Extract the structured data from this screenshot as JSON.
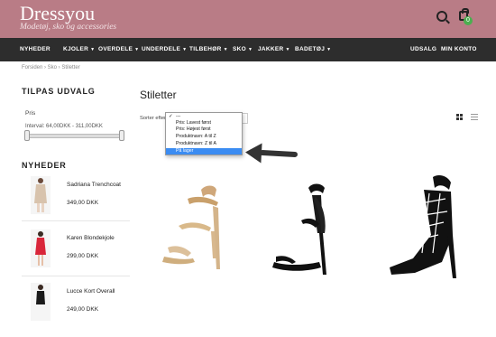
{
  "header": {
    "logo": "Dressyou",
    "tagline": "Modetøj, sko og accessories",
    "cart_count": "0",
    "brand_color": "#b97c86"
  },
  "nav": {
    "items": [
      {
        "label": "NYHEDER",
        "caret": false
      },
      {
        "label": "KJOLER",
        "caret": true
      },
      {
        "label": "OVERDELE",
        "caret": true
      },
      {
        "label": "UNDERDELE",
        "caret": true
      },
      {
        "label": "TILBEHØR",
        "caret": true
      },
      {
        "label": "SKO",
        "caret": true
      },
      {
        "label": "JAKKER",
        "caret": true
      },
      {
        "label": "BADETØJ",
        "caret": true
      }
    ],
    "right": [
      {
        "label": "UDSALG"
      },
      {
        "label": "MIN KONTO"
      }
    ]
  },
  "breadcrumb": "Forsiden  ›  Sko  ›  Stiletter",
  "sidebar": {
    "filter_title": "TILPAS UDVALG",
    "price_label": "Pris",
    "interval": "Interval: 64,00DKK - 311,00DKK",
    "new_title": "NYHEDER",
    "products": [
      {
        "name": "Sadriana Trenchcoat",
        "price": "349,00 DKK"
      },
      {
        "name": "Karen Blondekjole",
        "price": "299,00 DKK"
      },
      {
        "name": "Lucce Kort Overall",
        "price": "249,00 DKK"
      }
    ]
  },
  "main": {
    "title": "Stiletter",
    "sort_label": "Sorter efter",
    "sort_options": [
      {
        "label": "---",
        "checked": true,
        "selected": false
      },
      {
        "label": "Pris: Lavest først",
        "checked": false,
        "selected": false
      },
      {
        "label": "Pris: Højest først",
        "checked": false,
        "selected": false
      },
      {
        "label": "Produktnavn: A til Z",
        "checked": false,
        "selected": false
      },
      {
        "label": "Produktnavn: Z til A",
        "checked": false,
        "selected": false
      },
      {
        "label": "På lager",
        "checked": false,
        "selected": true
      }
    ],
    "products": [
      {
        "icon": "gold-stiletto-sandal"
      },
      {
        "icon": "black-stiletto-sandal"
      },
      {
        "icon": "black-caged-stiletto"
      }
    ]
  }
}
